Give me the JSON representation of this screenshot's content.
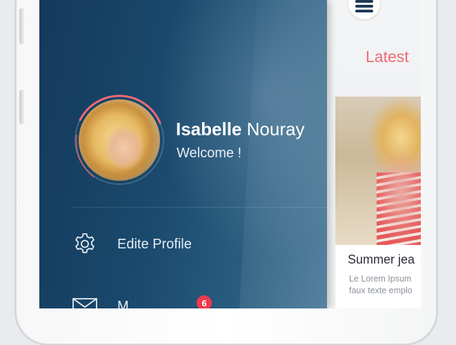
{
  "drawer": {
    "user_first_name": "Isabelle",
    "user_last_name": "Nouray",
    "welcome_text": "Welcome !",
    "menu": [
      {
        "label": "Edite Profile",
        "icon": "gear-icon"
      },
      {
        "label": "M",
        "icon": "envelope-icon",
        "badge": "6"
      }
    ]
  },
  "main": {
    "tab_label": "Latest",
    "card": {
      "title": "Summer jea",
      "text_line1": "Le Lorem Ipsum",
      "text_line2": "faux texte emplo"
    }
  },
  "colors": {
    "accent": "#f06a73",
    "badge": "#ee3a4d",
    "drawer_bg": "#1a4a6e"
  }
}
